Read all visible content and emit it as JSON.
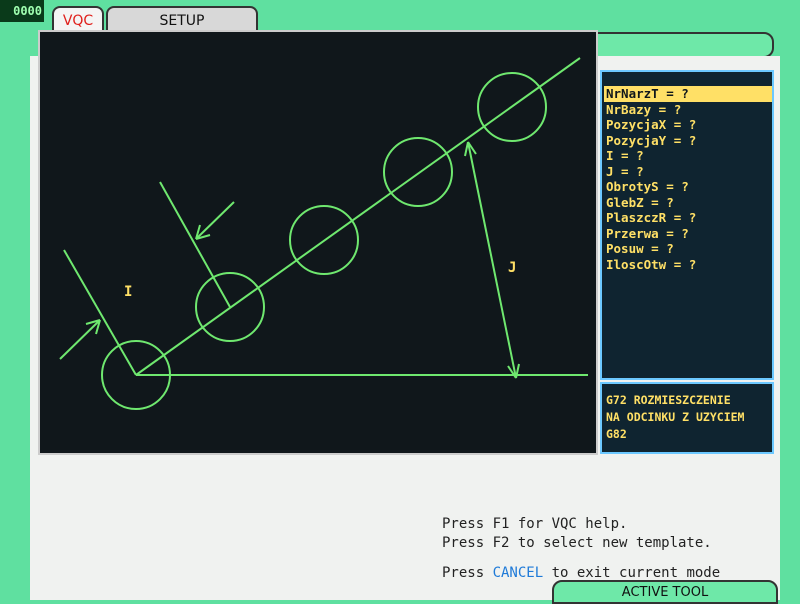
{
  "counter": "0000",
  "tabs": {
    "vqc": "VQC",
    "setup": "SETUP"
  },
  "params": [
    "NrNarzT = ?",
    "NrBazy = ?",
    "PozycjaX = ?",
    "PozycjaY = ?",
    "I = ?",
    "J = ?",
    "ObrotyS = ?",
    "GlebZ = ?",
    "PlaszczR = ?",
    "Przerwa = ?",
    "Posuw = ?",
    "IloscOtw = ?"
  ],
  "selected_param_index": 0,
  "description": {
    "line1": "G72 ROZMIESZCZENIE",
    "line2": "NA ODCINKU Z UZYCIEM",
    "line3": "G82"
  },
  "diagram": {
    "label_i": "I",
    "label_j": "J"
  },
  "help": {
    "line1": "Press F1 for VQC help.",
    "line2": "Press F2 to select new template.",
    "exit_prefix": "Press ",
    "exit_key": "CANCEL",
    "exit_suffix": " to exit current mode"
  },
  "active_tool": "ACTIVE TOOL",
  "colors": {
    "screen_bg": "#10171b",
    "drawing": "#6fe86f",
    "param_text": "#ffe066",
    "panel_border": "#6cc8ff",
    "frame_green": "#5fe0a0",
    "tab_active_text": "#e0201c",
    "cancel_key": "#1e7ad8"
  }
}
